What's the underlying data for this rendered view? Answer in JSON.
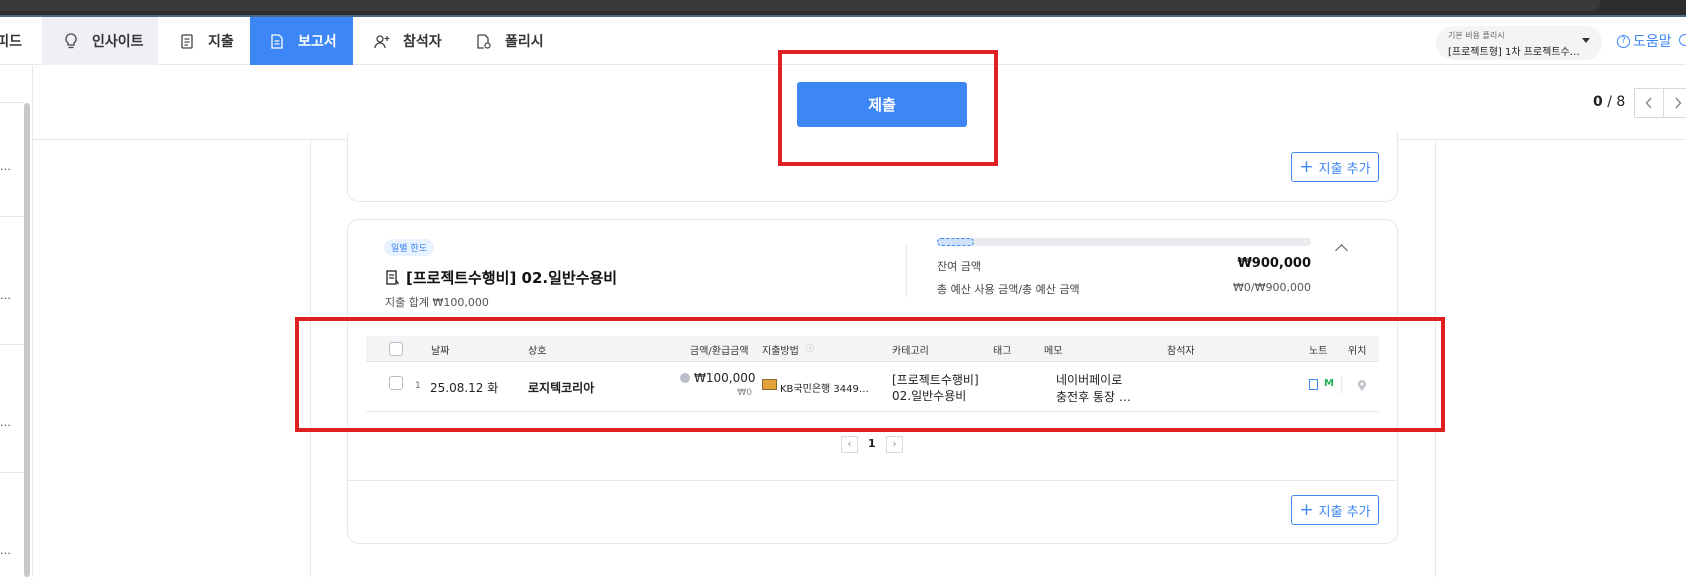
{
  "nav": {
    "partial_tab": "피드",
    "tabs": [
      {
        "label": "인사이트",
        "icon": "lightbulb-icon"
      },
      {
        "label": "지출",
        "icon": "receipt-icon"
      },
      {
        "label": "보고서",
        "icon": "document-icon"
      },
      {
        "label": "참석자",
        "icon": "user-add-icon"
      },
      {
        "label": "폴리시",
        "icon": "policy-icon"
      }
    ],
    "active_tab": "보고서"
  },
  "policy_selector": {
    "label": "기본 비용 폴리시",
    "value": "[프로젝트형] 1차 프로젝트수…"
  },
  "help_label": "도움말",
  "action_bar": {
    "submit_label": "제출",
    "pager_current": "0",
    "pager_total": "/ 8"
  },
  "add_expense_label": "지출 추가",
  "category_card": {
    "badge": "일별 한도",
    "title": "[프로젝트수행비] 02.일반수용비",
    "sum_line": "지출 합계 ₩100,000",
    "remaining_label": "잔여 금액",
    "remaining_value": "₩900,000",
    "total_label": "총 예산 사용 금액/총 예산 금액",
    "total_value": "₩0/₩900,000",
    "budget_used_fraction": 0.1
  },
  "table": {
    "headers": {
      "date": "날짜",
      "merchant": "상호",
      "amount": "금액/환급금액",
      "method": "지출방법",
      "category": "카테고리",
      "tag": "태그",
      "memo": "메모",
      "attendee": "참석자",
      "note": "노트",
      "location": "위치"
    },
    "rows": [
      {
        "index": "1",
        "date": "25.08.12 화",
        "merchant": "로지텍코리아",
        "amount": "₩100,000",
        "refund": "₩0",
        "method": "KB국민은행 3449…",
        "category_line1": "[프로젝트수행비]",
        "category_line2": "02.일반수용비",
        "memo_line1": "네이버페이로",
        "memo_line2": "충전후 통장 …"
      }
    ],
    "pagination": {
      "current": "1"
    }
  },
  "colors": {
    "accent": "#3d86f5",
    "annotation": "#e02020"
  }
}
